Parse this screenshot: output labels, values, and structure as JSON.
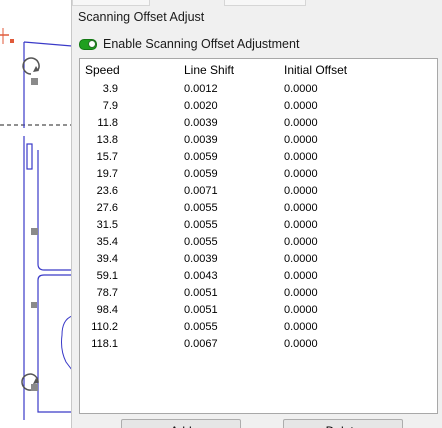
{
  "dialog": {
    "group_title": "Scanning Offset Adjust",
    "enable_label": "Enable Scanning Offset Adjustment",
    "enabled": true
  },
  "table": {
    "headers": {
      "speed": "Speed",
      "line_shift": "Line Shift",
      "initial_offset": "Initial Offset"
    },
    "rows": [
      {
        "speed": "3.9",
        "line_shift": "0.0012",
        "initial_offset": "0.0000"
      },
      {
        "speed": "7.9",
        "line_shift": "0.0020",
        "initial_offset": "0.0000"
      },
      {
        "speed": "11.8",
        "line_shift": "0.0039",
        "initial_offset": "0.0000"
      },
      {
        "speed": "13.8",
        "line_shift": "0.0039",
        "initial_offset": "0.0000"
      },
      {
        "speed": "15.7",
        "line_shift": "0.0059",
        "initial_offset": "0.0000"
      },
      {
        "speed": "19.7",
        "line_shift": "0.0059",
        "initial_offset": "0.0000"
      },
      {
        "speed": "23.6",
        "line_shift": "0.0071",
        "initial_offset": "0.0000"
      },
      {
        "speed": "27.6",
        "line_shift": "0.0055",
        "initial_offset": "0.0000"
      },
      {
        "speed": "31.5",
        "line_shift": "0.0055",
        "initial_offset": "0.0000"
      },
      {
        "speed": "35.4",
        "line_shift": "0.0055",
        "initial_offset": "0.0000"
      },
      {
        "speed": "39.4",
        "line_shift": "0.0039",
        "initial_offset": "0.0000"
      },
      {
        "speed": "59.1",
        "line_shift": "0.0043",
        "initial_offset": "0.0000"
      },
      {
        "speed": "78.7",
        "line_shift": "0.0051",
        "initial_offset": "0.0000"
      },
      {
        "speed": "98.4",
        "line_shift": "0.0051",
        "initial_offset": "0.0000"
      },
      {
        "speed": "110.2",
        "line_shift": "0.0055",
        "initial_offset": "0.0000"
      },
      {
        "speed": "118.1",
        "line_shift": "0.0067",
        "initial_offset": "0.0000"
      }
    ]
  },
  "buttons": {
    "add_label": "Add",
    "delete_label": "Delete"
  },
  "icons": {
    "rotate": "rotate-icon",
    "handle": "resize-handle-icon",
    "toggle": "toggle-switch"
  },
  "colors": {
    "toggle_on": "#1fa01f",
    "canvas_outline": "#3a3ac8",
    "origin_marker": "#e05a3a"
  }
}
